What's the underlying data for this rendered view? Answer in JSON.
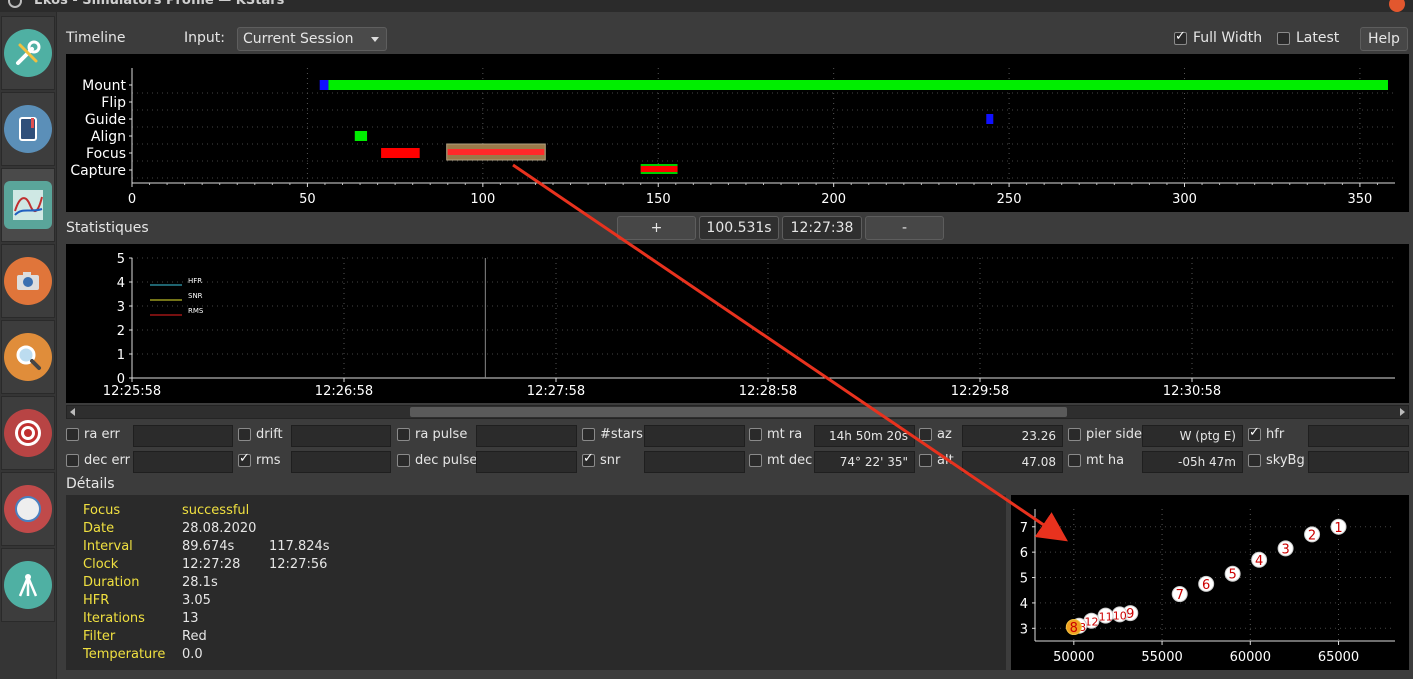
{
  "window": {
    "title": "Ekos - Simulators Profile — KStars"
  },
  "sidebar": {
    "items": [
      {
        "name": "setup-icon",
        "color": "#4fb0a3"
      },
      {
        "name": "scheduler-icon",
        "color": "#5b8fb8"
      },
      {
        "name": "analyze-icon",
        "color": "#5aa59a"
      },
      {
        "name": "capture-icon",
        "color": "#e0753a"
      },
      {
        "name": "focus-icon",
        "color": "#e08d3a"
      },
      {
        "name": "guide-icon",
        "color": "#b84444"
      },
      {
        "name": "align-icon",
        "color": "#c04a4a"
      },
      {
        "name": "mount-icon",
        "color": "#4fb0a3"
      }
    ]
  },
  "header": {
    "timeline_label": "Timeline",
    "input_label": "Input:",
    "input_value": "Current Session",
    "full_width_label": "Full Width",
    "full_width_checked": true,
    "latest_label": "Latest",
    "latest_checked": false,
    "help_label": "Help"
  },
  "timeline": {
    "rows": [
      "Mount",
      "Flip",
      "Guide",
      "Align",
      "Focus",
      "Capture"
    ],
    "x_ticks": [
      0,
      50,
      100,
      150,
      200,
      250,
      300,
      350
    ],
    "xlim": [
      0,
      360
    ],
    "segments": [
      {
        "row": "Mount",
        "start": 53.5,
        "end": 56,
        "color": "#1010ff",
        "kind": "solid"
      },
      {
        "row": "Mount",
        "start": 56,
        "end": 358,
        "color": "#00ee00",
        "kind": "solid"
      },
      {
        "row": "Guide",
        "start": 243.5,
        "end": 245.5,
        "color": "#1010ff",
        "kind": "solid"
      },
      {
        "row": "Align",
        "start": 63.5,
        "end": 67,
        "color": "#00ee00",
        "kind": "solid"
      },
      {
        "row": "Focus",
        "start": 71,
        "end": 82,
        "color": "#ff0000",
        "kind": "solid"
      },
      {
        "row": "Focus",
        "start": 89.7,
        "end": 117.8,
        "color": "#ff2a2a",
        "kind": "selected"
      },
      {
        "row": "Capture",
        "start": 145,
        "end": 155.5,
        "color": "#ff0000",
        "kind": "capture"
      }
    ]
  },
  "statistics": {
    "label": "Statistiques",
    "plus_label": "+",
    "time_value": "100.531s",
    "clock_value": "12:27:38",
    "minus_label": "-",
    "y_ticks": [
      0,
      1,
      2,
      3,
      4,
      5
    ],
    "x_ticks": [
      "12:25:58",
      "12:26:58",
      "12:27:58",
      "12:28:58",
      "12:29:58",
      "12:30:58"
    ],
    "legend": [
      {
        "name": "HFR",
        "color": "#3ec7e0"
      },
      {
        "name": "SNR",
        "color": "#e8e830"
      },
      {
        "name": "RMS",
        "color": "#ee2020"
      }
    ],
    "cursor_time": "12:27:38"
  },
  "stat_fields": {
    "row1": [
      {
        "label": "ra err",
        "checked": false,
        "value": ""
      },
      {
        "label": "drift",
        "checked": false,
        "value": ""
      },
      {
        "label": "ra pulse",
        "checked": false,
        "value": ""
      },
      {
        "label": "#stars",
        "checked": false,
        "value": ""
      },
      {
        "label": "mt ra",
        "checked": false,
        "value": "14h 50m 20s"
      },
      {
        "label": "az",
        "checked": false,
        "value": "23.26"
      },
      {
        "label": "pier side",
        "checked": false,
        "value": "W (ptg E)"
      },
      {
        "label": "hfr",
        "checked": true,
        "value": ""
      }
    ],
    "row2": [
      {
        "label": "dec err",
        "checked": false,
        "value": ""
      },
      {
        "label": "rms",
        "checked": true,
        "value": ""
      },
      {
        "label": "dec pulse",
        "checked": false,
        "value": ""
      },
      {
        "label": "snr",
        "checked": true,
        "value": ""
      },
      {
        "label": "mt dec",
        "checked": false,
        "value": "74° 22' 35\""
      },
      {
        "label": "alt",
        "checked": false,
        "value": "47.08"
      },
      {
        "label": "mt ha",
        "checked": false,
        "value": "-05h 47m"
      },
      {
        "label": "skyBg",
        "checked": false,
        "value": ""
      }
    ]
  },
  "details": {
    "label": "Détails",
    "rows": [
      {
        "key": "Focus",
        "value": "successful",
        "value2": "",
        "highlight": true
      },
      {
        "key": "Date",
        "value": "28.08.2020",
        "value2": ""
      },
      {
        "key": "Interval",
        "value": "89.674s",
        "value2": "117.824s"
      },
      {
        "key": "Clock",
        "value": "12:27:28",
        "value2": "12:27:56"
      },
      {
        "key": "Duration",
        "value": "28.1s",
        "value2": ""
      },
      {
        "key": "HFR",
        "value": "3.05",
        "value2": ""
      },
      {
        "key": "Iterations",
        "value": "13",
        "value2": ""
      },
      {
        "key": "Filter",
        "value": "Red",
        "value2": ""
      },
      {
        "key": "Temperature",
        "value": "0.0",
        "value2": ""
      }
    ]
  },
  "chart_data": {
    "type": "scatter",
    "title": "",
    "xlabel": "",
    "ylabel": "",
    "xlim": [
      47800,
      68200
    ],
    "ylim": [
      2.5,
      7.7
    ],
    "x_ticks": [
      50000,
      55000,
      60000,
      65000
    ],
    "y_ticks": [
      3,
      4,
      5,
      6,
      7
    ],
    "grid": true,
    "points": [
      {
        "label": "1",
        "x": 65000,
        "y": 7.0
      },
      {
        "label": "2",
        "x": 63500,
        "y": 6.7
      },
      {
        "label": "3",
        "x": 62000,
        "y": 6.15
      },
      {
        "label": "4",
        "x": 60500,
        "y": 5.7
      },
      {
        "label": "5",
        "x": 59000,
        "y": 5.15
      },
      {
        "label": "6",
        "x": 57500,
        "y": 4.75
      },
      {
        "label": "7",
        "x": 56000,
        "y": 4.35
      },
      {
        "label": "9",
        "x": 53200,
        "y": 3.6
      },
      {
        "label": "10",
        "x": 52600,
        "y": 3.55
      },
      {
        "label": "11",
        "x": 51800,
        "y": 3.5
      },
      {
        "label": "12",
        "x": 51000,
        "y": 3.3
      },
      {
        "label": "13",
        "x": 50300,
        "y": 3.1
      },
      {
        "label": "8",
        "x": 50000,
        "y": 3.05,
        "final": true
      }
    ]
  }
}
